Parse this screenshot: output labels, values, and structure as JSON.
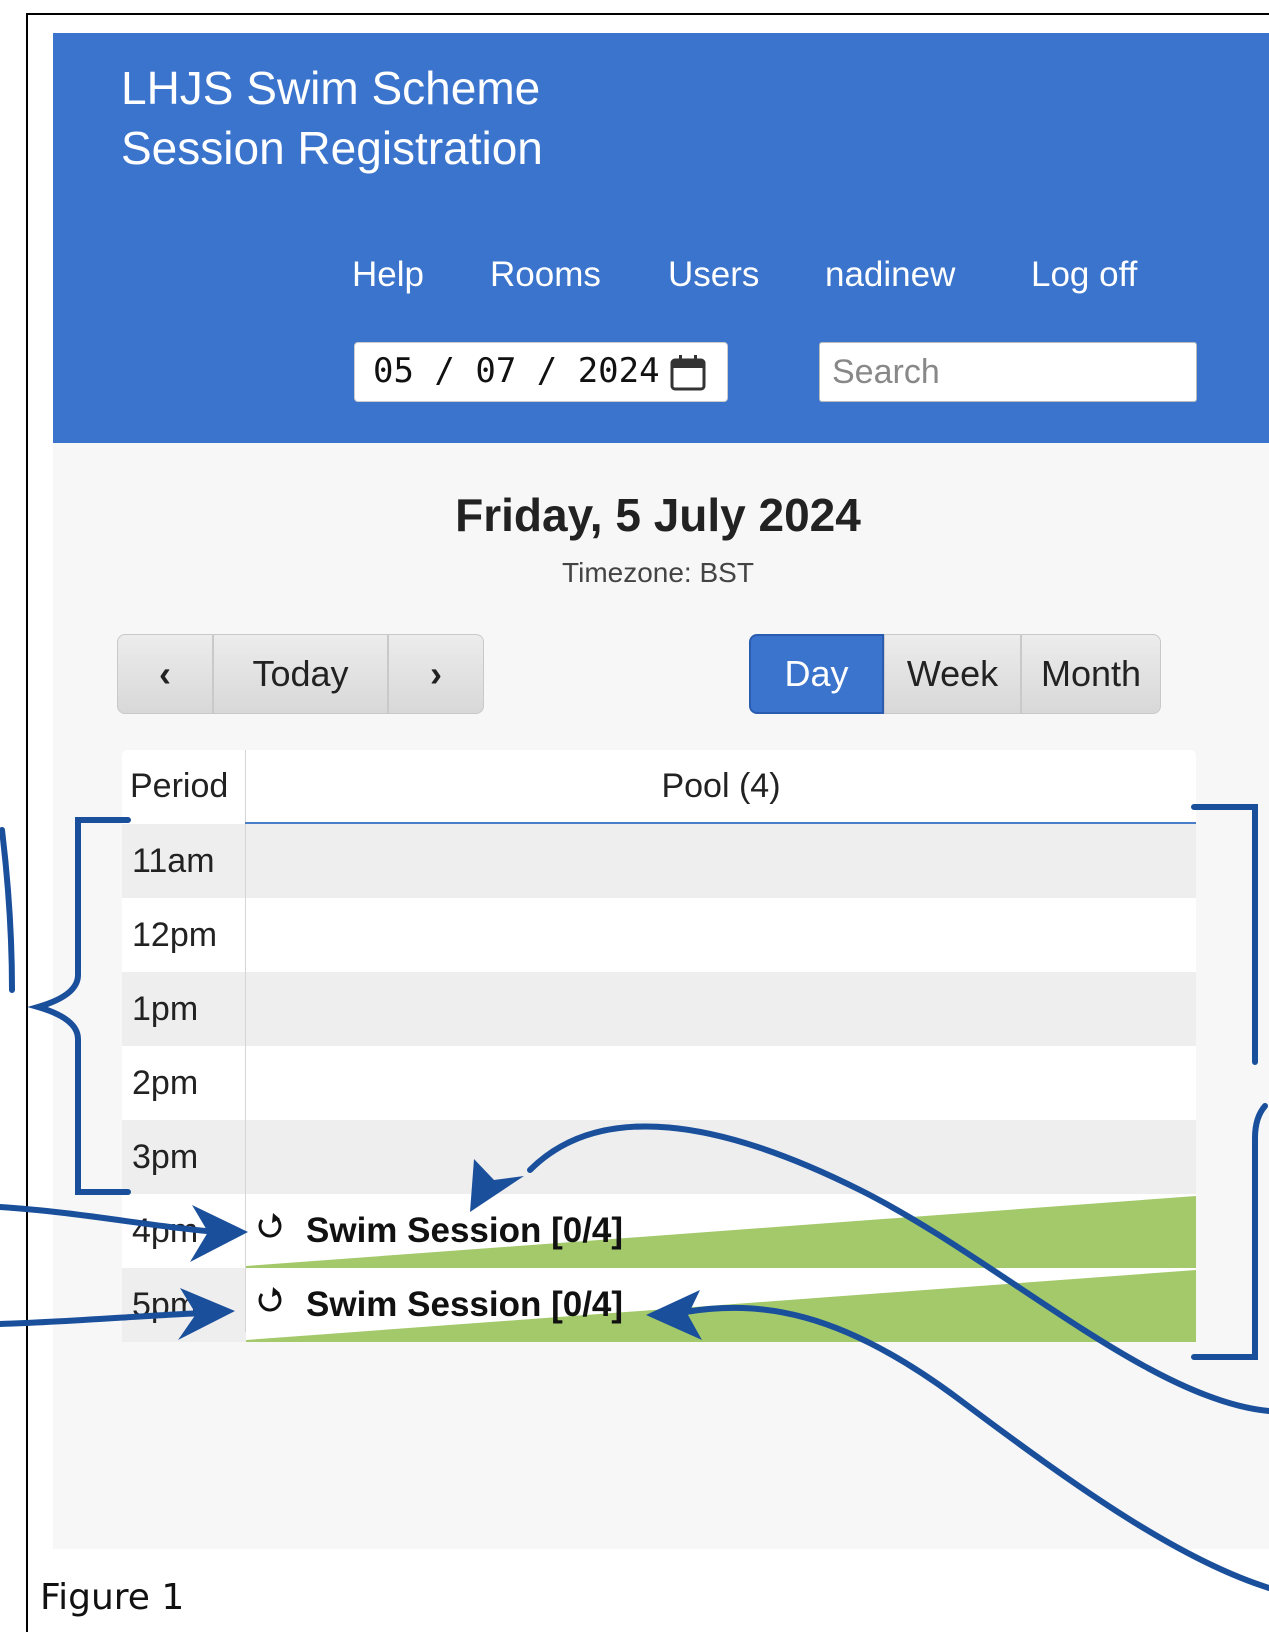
{
  "app": {
    "title_line1": "LHJS Swim Scheme",
    "title_line2": "Session Registration"
  },
  "nav": {
    "help": "Help",
    "rooms": "Rooms",
    "users": "Users",
    "username": "nadinew",
    "logoff": "Log off"
  },
  "date_picker": {
    "value": "05 / 07 / 2024",
    "icon": "calendar-icon"
  },
  "search": {
    "placeholder": "Search"
  },
  "day_view": {
    "title": "Friday, 5 July 2024",
    "timezone": "Timezone: BST"
  },
  "navigation_buttons": {
    "prev": "‹",
    "today": "Today",
    "next": "›"
  },
  "view_buttons": {
    "day": "Day",
    "week": "Week",
    "month": "Month",
    "active": "day"
  },
  "grid": {
    "col_period": "Period",
    "col_room": "Pool (4)",
    "rows": [
      {
        "period": "11am",
        "booking": null
      },
      {
        "period": "12pm",
        "booking": null
      },
      {
        "period": "1pm",
        "booking": null
      },
      {
        "period": "2pm",
        "booking": null
      },
      {
        "period": "3pm",
        "booking": null
      },
      {
        "period": "4pm",
        "booking": "Swim Session [0/4]",
        "recurring_icon": "repeat-icon"
      },
      {
        "period": "5pm",
        "booking": "Swim Session [0/4]",
        "recurring_icon": "repeat-icon"
      }
    ]
  },
  "caption": "Figure 1",
  "colors": {
    "header_blue": "#3b74cd",
    "booking_green": "#a3c96b",
    "annotation_blue": "#1a4f9c"
  }
}
